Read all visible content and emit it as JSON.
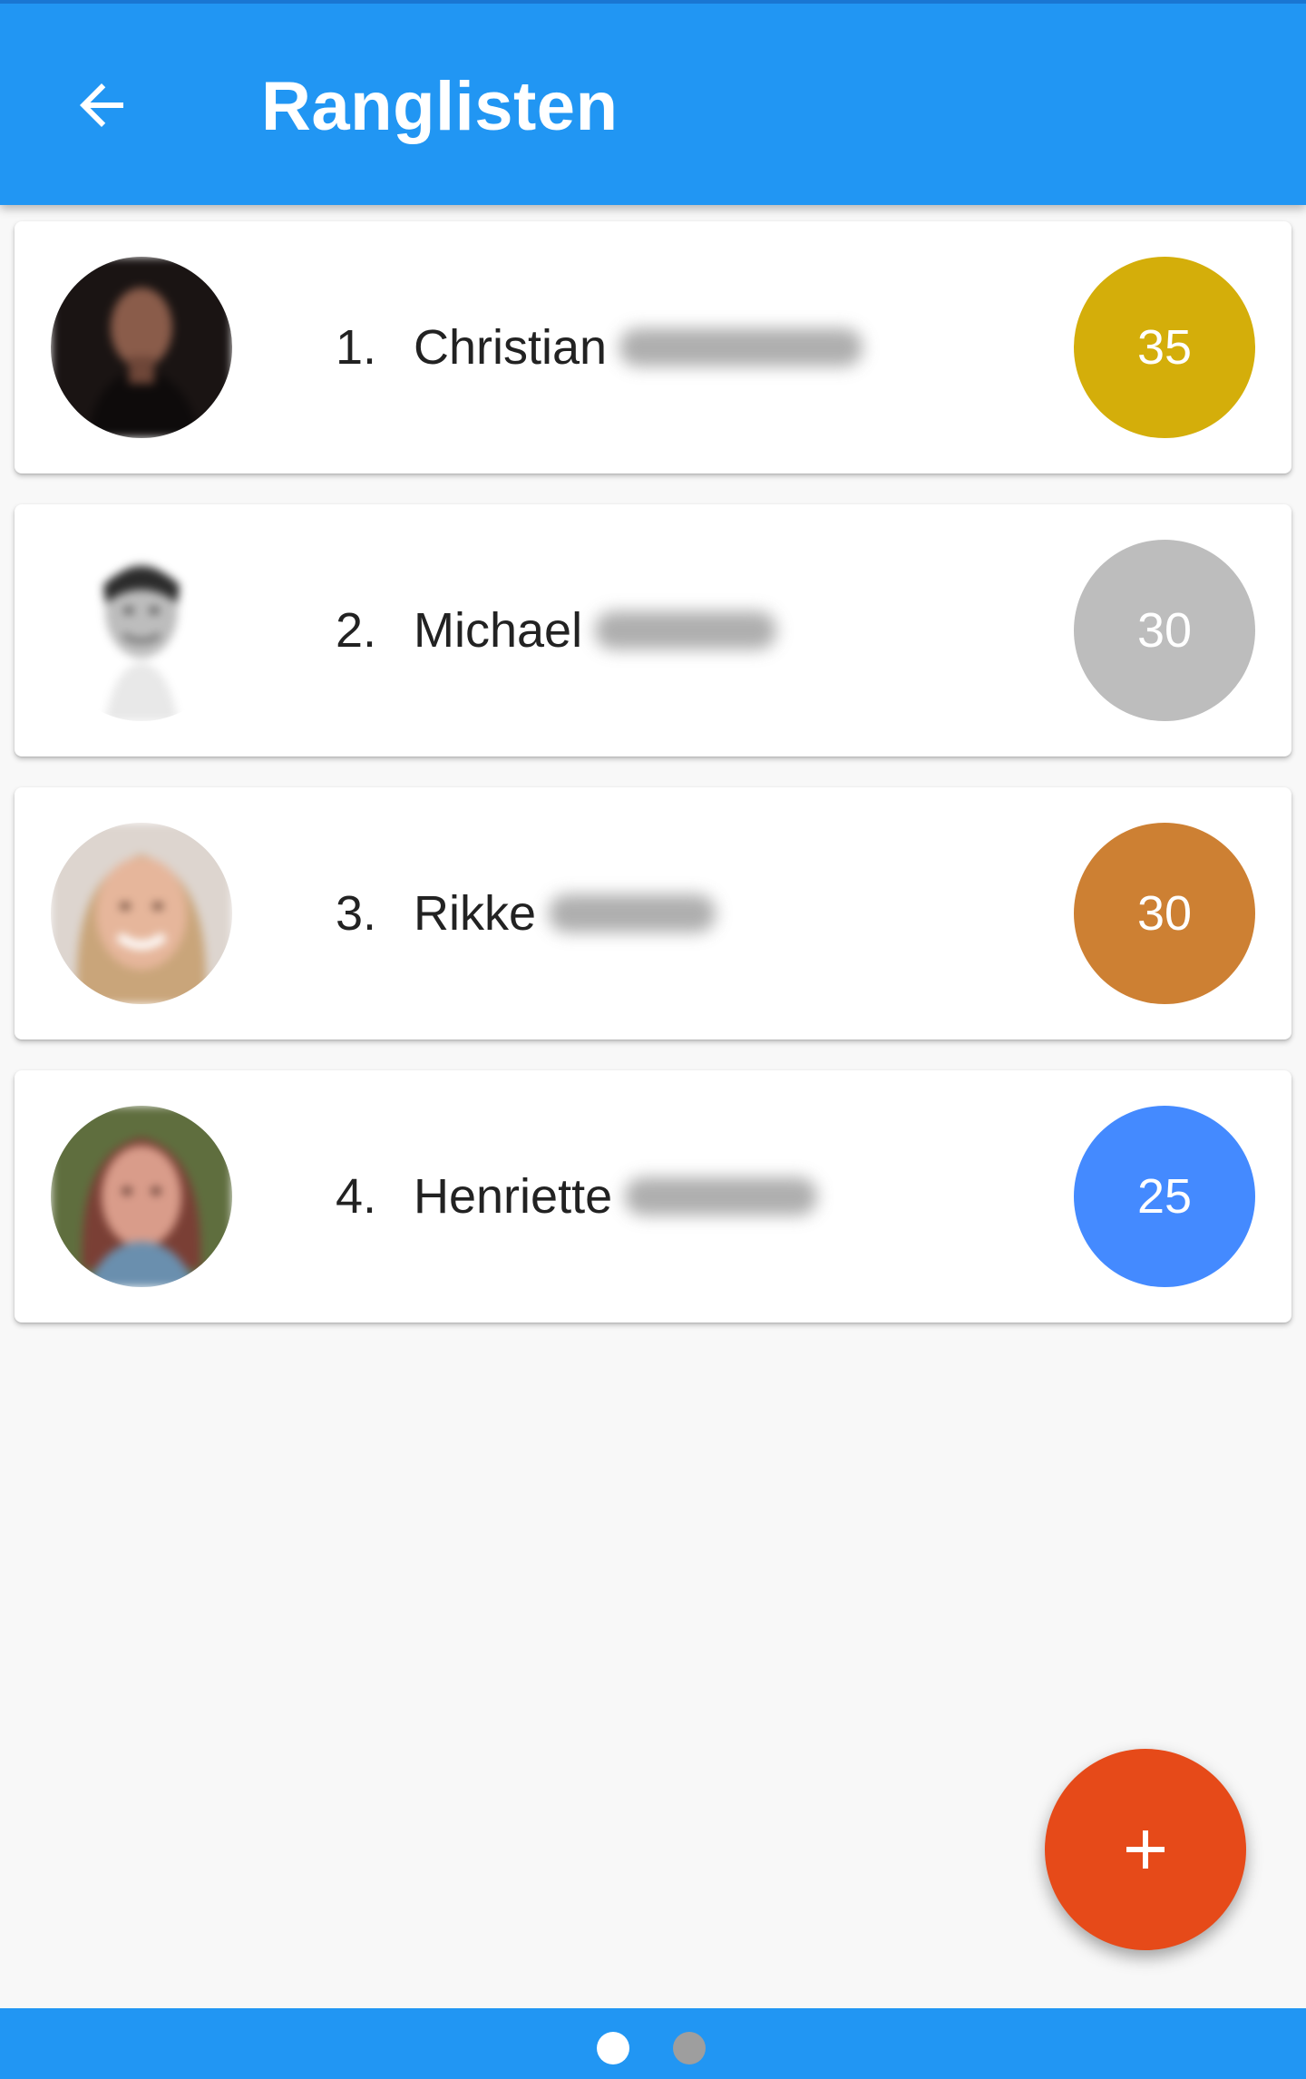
{
  "app_bar": {
    "title": "Ranglisten",
    "back_icon": "arrow-left-icon",
    "background": "#2196f3"
  },
  "leaderboard": [
    {
      "rank": "1.",
      "first_name": "Christian",
      "score": "35",
      "score_color": "#d4ae0a",
      "medal": "gold"
    },
    {
      "rank": "2.",
      "first_name": "Michael",
      "score": "30",
      "score_color": "#bdbdbd",
      "medal": "silver"
    },
    {
      "rank": "3.",
      "first_name": "Rikke",
      "score": "30",
      "score_color": "#cd8033",
      "medal": "bronze"
    },
    {
      "rank": "4.",
      "first_name": "Henriette",
      "score": "25",
      "score_color": "#448aff",
      "medal": "none"
    }
  ],
  "fab": {
    "icon": "plus-icon",
    "color": "#e64a19"
  },
  "pager": {
    "pages": 2,
    "active_page": 1,
    "active_color": "#ffffff",
    "inactive_color": "#9e9e9e"
  }
}
